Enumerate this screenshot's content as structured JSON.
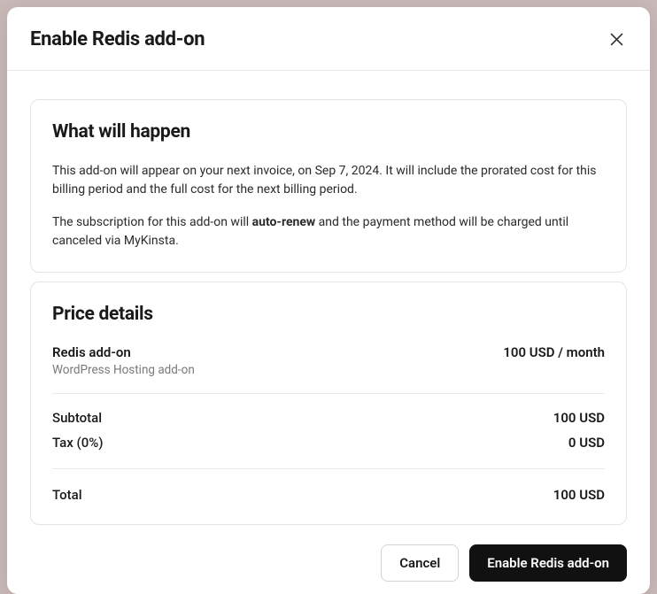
{
  "modal": {
    "title": "Enable Redis add-on"
  },
  "info_card": {
    "title": "What will happen",
    "description_pre": "This add-on will appear on your next invoice, on Sep 7, 2024. It will include the prorated cost for this billing period and the full cost for the next billing period.",
    "subscription_pre": "The subscription for this add-on will ",
    "subscription_bold": "auto-renew",
    "subscription_post": " and the payment method will be charged until canceled via MyKinsta."
  },
  "price_card": {
    "title": "Price details",
    "item_name": "Redis add-on",
    "item_sub": "WordPress Hosting add-on",
    "item_price": "100 USD / month",
    "subtotal_label": "Subtotal",
    "subtotal_value": "100 USD",
    "tax_label": "Tax (0%)",
    "tax_value": "0 USD",
    "total_label": "Total",
    "total_value": "100 USD"
  },
  "footer": {
    "cancel": "Cancel",
    "confirm": "Enable Redis add-on"
  }
}
